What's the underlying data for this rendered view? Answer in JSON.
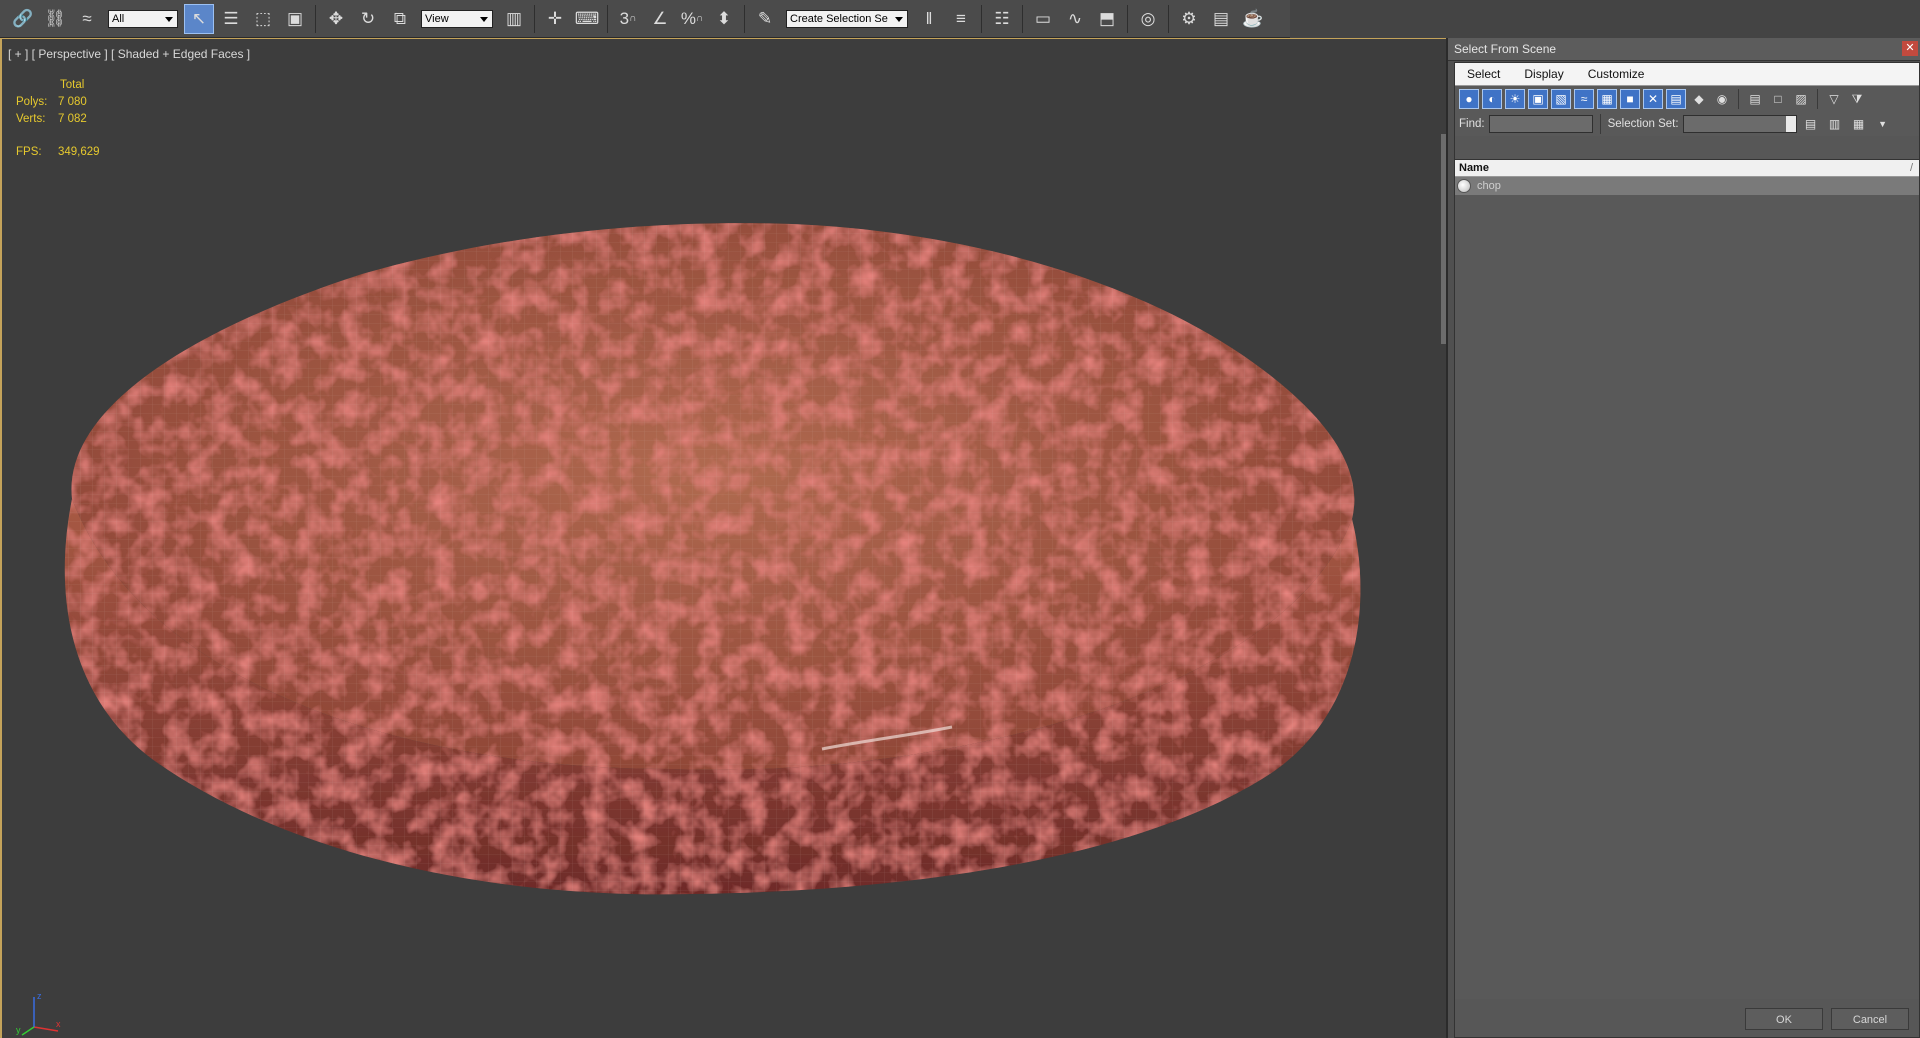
{
  "toolbar": {
    "selection_filter": "All",
    "ref_coord": "View",
    "named_selection_placeholder": "Create Selection Se",
    "snap3": "3",
    "percent_snap": "%"
  },
  "viewport": {
    "label": "[ + ] [ Perspective ] [ Shaded + Edged Faces ]",
    "stats": {
      "header": "Total",
      "polys_label": "Polys:",
      "polys_value": "7 080",
      "verts_label": "Verts:",
      "verts_value": "7 082",
      "fps_label": "FPS:",
      "fps_value": "349,629"
    },
    "axis": {
      "x": "x",
      "y": "y",
      "z": "z"
    }
  },
  "dialog": {
    "title": "Select From Scene",
    "close_glyph": "✕",
    "menu": [
      "Select",
      "Display",
      "Customize"
    ],
    "find_label": "Find:",
    "find_value": "",
    "selection_set_label": "Selection Set:",
    "selection_set_value": "",
    "column_header": "Name",
    "column_sort": "/",
    "rows": [
      {
        "name": "chop",
        "icon": "sphere-icon"
      }
    ],
    "ok_label": "OK",
    "cancel_label": "Cancel"
  },
  "colors": {
    "viewport_bg": "#3d3d3d",
    "active_border": "#c4a35a",
    "stats_text": "#e6c92e",
    "tool_active": "#5b86c9",
    "patty_base": "#9a4a3a"
  }
}
